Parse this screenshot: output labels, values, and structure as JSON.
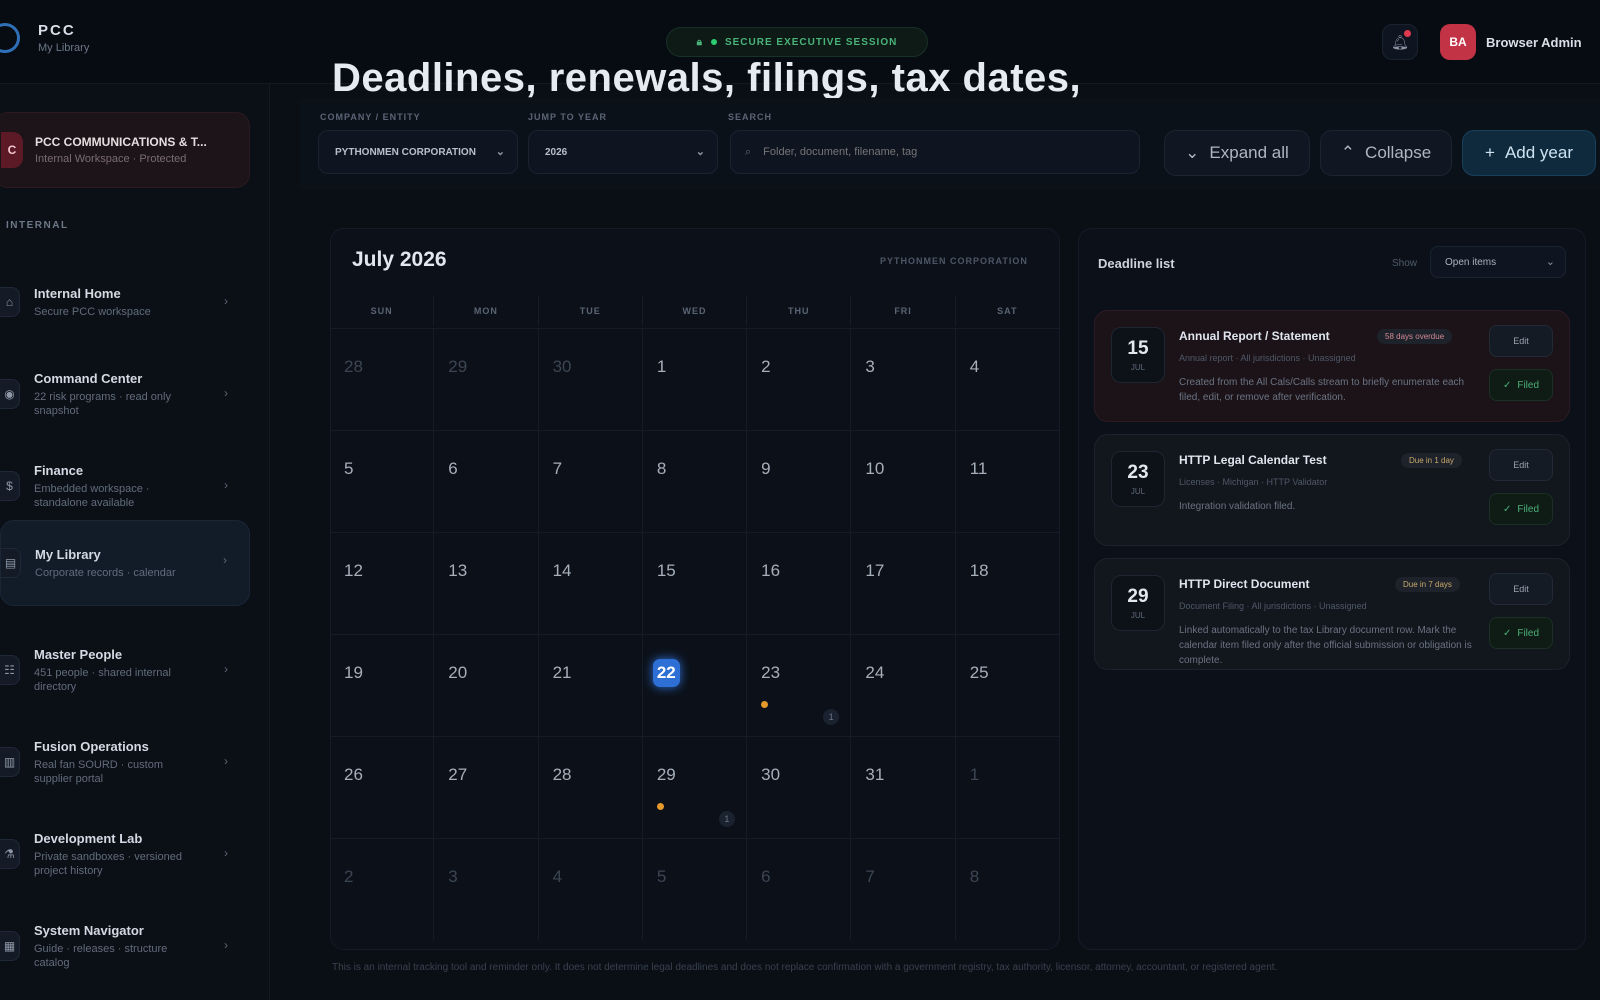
{
  "brand": {
    "name": "PCC",
    "sub": "My Library"
  },
  "topbar": {
    "secure_label": "SECURE EXECUTIVE SESSION",
    "user_initials": "BA",
    "user_name": "Browser Admin"
  },
  "sidebar": {
    "company": {
      "badge": "C",
      "name": "PCC COMMUNICATIONS & T...",
      "sub": "Internal Workspace · Protected"
    },
    "section_label": "INTERNAL",
    "items": [
      {
        "title": "Internal Home",
        "sub": "Secure PCC workspace",
        "icon": "home-icon",
        "glyph": "⌂"
      },
      {
        "title": "Command Center",
        "sub": "22 risk programs · read only snapshot",
        "icon": "eye-icon",
        "glyph": "◉"
      },
      {
        "title": "Finance",
        "sub": "Embedded workspace · standalone available",
        "icon": "dollar-icon",
        "glyph": "$"
      },
      {
        "title": "My Library",
        "sub": "Corporate records · calendar",
        "icon": "library-icon",
        "glyph": "▤"
      },
      {
        "title": "Master People",
        "sub": "451 people · shared internal directory",
        "icon": "people-icon",
        "glyph": "☷"
      },
      {
        "title": "Fusion Operations",
        "sub": "Real fan SOURD · custom supplier portal",
        "icon": "server-icon",
        "glyph": "▥"
      },
      {
        "title": "Development Lab",
        "sub": "Private sandboxes · versioned project history",
        "icon": "flask-icon",
        "glyph": "⚗"
      },
      {
        "title": "System Navigator",
        "sub": "Guide · releases · structure catalog",
        "icon": "grid-icon",
        "glyph": "▦"
      }
    ]
  },
  "main": {
    "headline": "Deadlines, renewals, filings, tax dates,",
    "company_label": "COMPANY / ENTITY",
    "company_value": "PYTHONMEN CORPORATION",
    "year_label": "JUMP TO YEAR",
    "year_value": "2026",
    "search_label": "SEARCH",
    "search_placeholder": "Folder, document, filename, tag",
    "expand_label": "Expand all",
    "collapse_label": "Collapse",
    "add_label": "Add year"
  },
  "calendar": {
    "title": "July 2026",
    "entity": "PYTHONMEN CORPORATION",
    "weekdays": [
      "SUN",
      "MON",
      "TUE",
      "WED",
      "THU",
      "FRI",
      "SAT"
    ],
    "days": [
      "28",
      "29",
      "30",
      "1",
      "2",
      "3",
      "4",
      "5",
      "6",
      "7",
      "8",
      "9",
      "10",
      "11",
      "12",
      "13",
      "14",
      "15",
      "16",
      "17",
      "18",
      "19",
      "20",
      "21",
      "22",
      "23",
      "24",
      "25",
      "26",
      "27",
      "28",
      "29",
      "30",
      "31",
      "1",
      "2",
      "3",
      "4",
      "5",
      "6",
      "7",
      "8"
    ],
    "muted": [
      0,
      1,
      2,
      34,
      35,
      36,
      37,
      38,
      39,
      40,
      41
    ],
    "today_index": 24,
    "events": [
      {
        "index": 25,
        "count": "1"
      },
      {
        "index": 31,
        "count": "1"
      }
    ]
  },
  "deadlines": {
    "title": "Deadline list",
    "show_label": "Show",
    "filter": "Open items",
    "edit_label": "Edit",
    "filed_label": "Filed",
    "items": [
      {
        "day": "15",
        "month": "JUL",
        "name": "Annual Report / Statement",
        "tag": "58 days overdue",
        "meta": "Annual report · All jurisdictions · Unassigned",
        "desc": "Created from the All Cals/Calls stream to briefly enumerate each filed, edit, or remove after verification.",
        "tone": "red"
      },
      {
        "day": "23",
        "month": "JUL",
        "name": "HTTP Legal Calendar Test",
        "tag": "Due in 1 day",
        "meta": "Licenses · Michigan · HTTP Validator",
        "desc": "Integration validation filed.",
        "tone": "amber"
      },
      {
        "day": "29",
        "month": "JUL",
        "name": "HTTP Direct Document",
        "tag": "Due in 7 days",
        "meta": "Document Filing · All jurisdictions · Unassigned",
        "desc": "Linked automatically to the tax Library document row. Mark the calendar item filed only after the official submission or obligation is complete.",
        "tone": "amber"
      }
    ]
  },
  "footer": "This is an internal tracking tool and reminder only. It does not determine legal deadlines and does not replace confirmation with a government registry, tax authority, licensor, attorney, accountant, or registered agent."
}
